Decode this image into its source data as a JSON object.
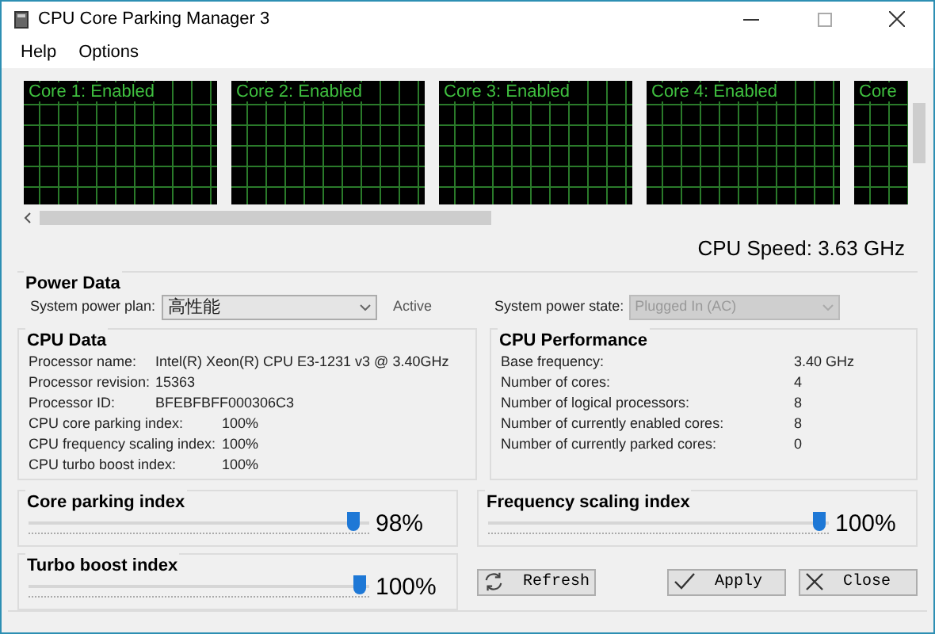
{
  "window": {
    "title": "CPU Core Parking Manager 3"
  },
  "menu": [
    "Help",
    "Options"
  ],
  "cores": [
    {
      "label": "Core 1: Enabled"
    },
    {
      "label": "Core 2: Enabled"
    },
    {
      "label": "Core 3: Enabled"
    },
    {
      "label": "Core 4: Enabled"
    },
    {
      "label": "Core"
    }
  ],
  "cpu_speed": "CPU Speed: 3.63 GHz",
  "power_data": {
    "title": "Power Data",
    "plan_label": "System power plan:",
    "plan_value": "高性能",
    "plan_status": "Active",
    "state_label": "System power state:",
    "state_value": "Plugged In (AC)",
    "state_disabled": true
  },
  "cpu_data": {
    "title": "CPU Data",
    "rows": [
      {
        "label": "Processor name:",
        "value": "Intel(R) Xeon(R) CPU E3-1231 v3 @ 3.40GHz"
      },
      {
        "label": "Processor revision:",
        "value": "15363"
      },
      {
        "label": "Processor ID:",
        "value": "BFEBFBFF000306C3"
      },
      {
        "label": "CPU core parking index:",
        "value": "100%"
      },
      {
        "label": "CPU frequency scaling index:",
        "value": "100%"
      },
      {
        "label": "CPU turbo boost index:",
        "value": "100%"
      }
    ]
  },
  "cpu_performance": {
    "title": "CPU Performance",
    "rows": [
      {
        "label": "Base frequency:",
        "value": "3.40 GHz"
      },
      {
        "label": "Number of cores:",
        "value": "4"
      },
      {
        "label": "Number of logical processors:",
        "value": "8"
      },
      {
        "label": "Number of currently enabled cores:",
        "value": "8"
      },
      {
        "label": "Number of currently parked cores:",
        "value": "0"
      }
    ]
  },
  "sliders": [
    {
      "title": "Core parking index",
      "level": 0.98,
      "reading": "98%"
    },
    {
      "title": "Frequency scaling index",
      "level": 1,
      "reading": "100%"
    },
    {
      "title": "Turbo boost index",
      "level": 1,
      "reading": "100%"
    }
  ],
  "buttons": [
    {
      "kind": "refresh",
      "label": "Refresh"
    },
    {
      "kind": "apply",
      "label": "Apply"
    },
    {
      "kind": "close",
      "label": "Close"
    }
  ]
}
